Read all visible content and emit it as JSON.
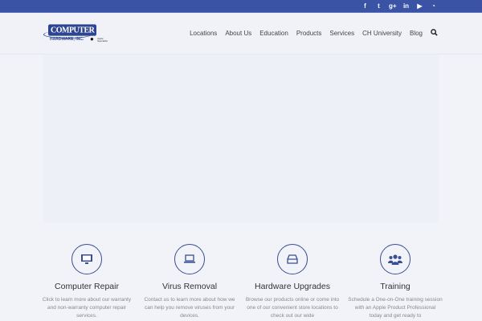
{
  "social": [
    {
      "icon": "facebook-icon",
      "glyph": "f"
    },
    {
      "icon": "twitter-icon",
      "glyph": "t"
    },
    {
      "icon": "google-plus-icon",
      "glyph": "g+"
    },
    {
      "icon": "linkedin-icon",
      "glyph": "in"
    },
    {
      "icon": "youtube-icon",
      "glyph": "▶"
    },
    {
      "icon": "rss-icon",
      "glyph": "◔"
    }
  ],
  "logo": {
    "main": "COMPUTER",
    "sub": "HARDWARE, INC.",
    "badge": "Apple Specialist"
  },
  "nav": [
    "Locations",
    "About Us",
    "Education",
    "Products",
    "Services",
    "CH University",
    "Blog"
  ],
  "search_glyph": "🔍",
  "features": [
    {
      "title": "Computer Repair",
      "text": "Click to learn more about our warranty and non-warranty computer repair services.",
      "icon": "▭"
    },
    {
      "title": "Virus Removal",
      "text": "Contact us to learn more about how we can help you remove viruses from your devices.",
      "icon": "⌨"
    },
    {
      "title": "Hardware Upgrades",
      "text": "Browse our products online or come into one of our convenient store locations to check out our wide",
      "icon": "⊟"
    },
    {
      "title": "Training",
      "text": "Schedule a One-on-One training session with an Apple Product Professional today and get ready to",
      "icon": "👥"
    }
  ],
  "colors": {
    "accent": "#3a53a4"
  }
}
